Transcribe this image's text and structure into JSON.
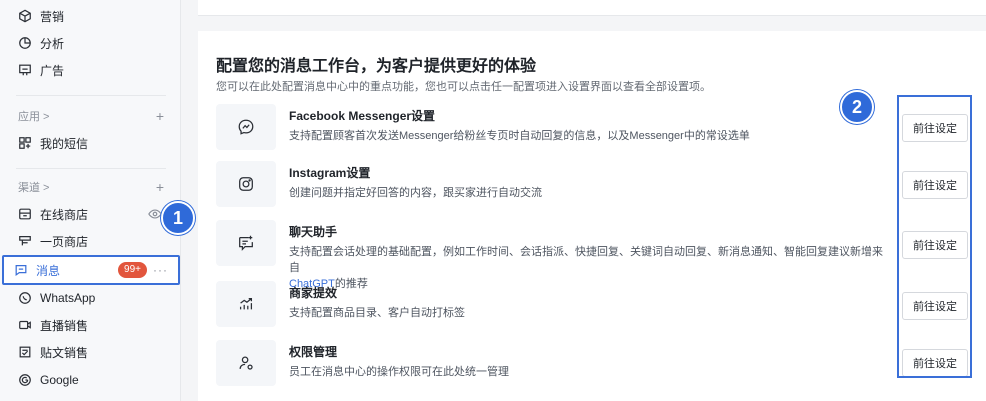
{
  "sidebar": {
    "top_items": [
      {
        "label": "营销",
        "icon": "cube-icon"
      },
      {
        "label": "分析",
        "icon": "pie-chart-icon"
      },
      {
        "label": "广告",
        "icon": "ad-board-icon"
      }
    ],
    "apps_section": {
      "label": "应用 >",
      "add": "+"
    },
    "apps_items": [
      {
        "label": "我的短信",
        "icon": "apps-grid-icon"
      }
    ],
    "channels_section": {
      "label": "渠道 >",
      "add": "+"
    },
    "channels_items": [
      {
        "label": "在线商店",
        "icon": "store-icon"
      },
      {
        "label": "一页商店",
        "icon": "one-page-store-icon"
      },
      {
        "label": "消息",
        "icon": "chat-icon",
        "badge": "99+",
        "more": "···",
        "active": true
      },
      {
        "label": "WhatsApp",
        "icon": "whatsapp-icon"
      },
      {
        "label": "直播销售",
        "icon": "live-video-icon"
      },
      {
        "label": "贴文销售",
        "icon": "post-icon"
      },
      {
        "label": "Google",
        "icon": "google-icon"
      }
    ]
  },
  "callouts": {
    "one": "1",
    "two": "2"
  },
  "main": {
    "title": "配置您的消息工作台，为客户提供更好的体验",
    "subtitle": "您可以在此处配置消息中心中的重点功能，您也可以点击任一配置项进入设置界面以查看全部设置项。",
    "settings": [
      {
        "icon": "messenger-icon",
        "title": "Facebook Messenger设置",
        "desc": "支持配置顾客首次发送Messenger给粉丝专页时自动回复的信息，以及Messenger中的常设选单",
        "button": "前往设定"
      },
      {
        "icon": "instagram-icon",
        "title": "Instagram设置",
        "desc": "创建问题并指定好回答的内容，跟买家进行自动交流",
        "button": "前往设定"
      },
      {
        "icon": "chat-assistant-icon",
        "title": "聊天助手",
        "desc": "支持配置会话处理的基础配置，例如工作时间、会话指派、快捷回复、关键词自动回复、新消息通知、智能回复建议新增来自",
        "desc_link": "ChatGPT",
        "desc_tail": "的推荐",
        "button": "前往设定"
      },
      {
        "icon": "efficiency-chart-icon",
        "title": "商家提效",
        "desc": "支持配置商品目录、客户自动打标签",
        "button": "前往设定"
      },
      {
        "icon": "user-permission-icon",
        "title": "权限管理",
        "desc": "员工在消息中心的操作权限可在此处统一管理",
        "button": "前往设定"
      }
    ]
  },
  "colors": {
    "accent": "#3a6fd8",
    "badge": "#e2563d",
    "callout": "#2f6ad9"
  }
}
